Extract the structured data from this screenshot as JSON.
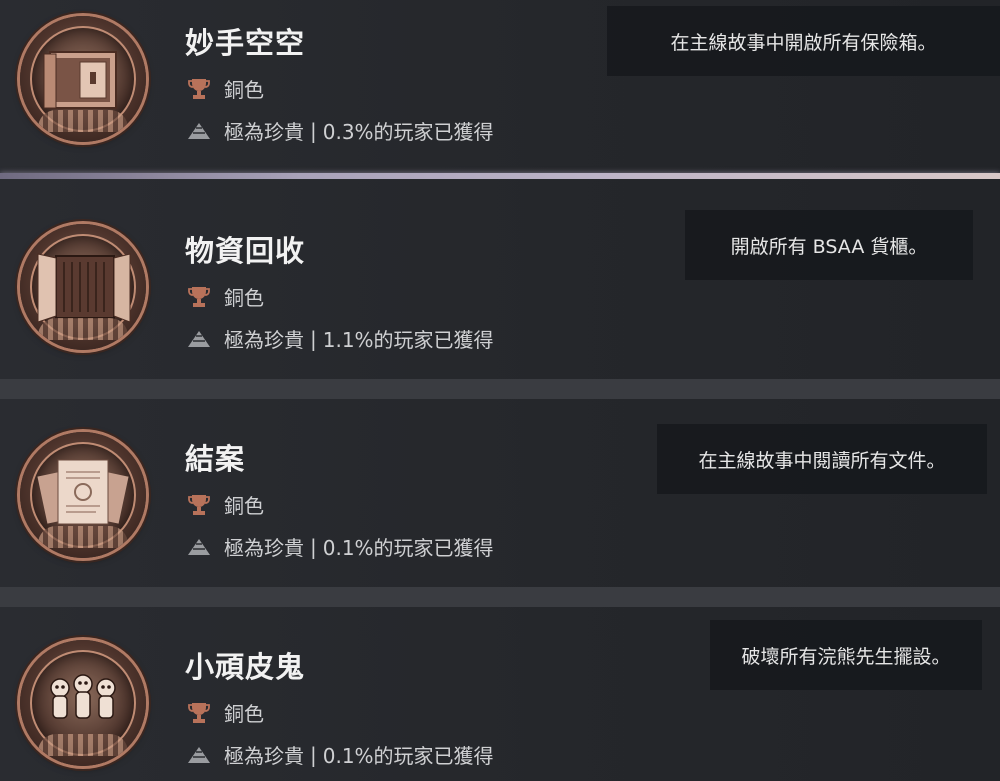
{
  "trophies": [
    {
      "name": "妙手空空",
      "grade": "銅色",
      "rarity": "極為珍貴",
      "percent": "0.3%的玩家已獲得",
      "description": "在主線故事中開啟所有保險箱。",
      "icon": "safe-icon"
    },
    {
      "name": "物資回收",
      "grade": "銅色",
      "rarity": "極為珍貴",
      "percent": "1.1%的玩家已獲得",
      "description": "開啟所有 BSAA 貨櫃。",
      "icon": "container-icon"
    },
    {
      "name": "結案",
      "grade": "銅色",
      "rarity": "極為珍貴",
      "percent": "0.1%的玩家已獲得",
      "description": "在主線故事中閱讀所有文件。",
      "icon": "documents-icon"
    },
    {
      "name": "小頑皮鬼",
      "grade": "銅色",
      "rarity": "極為珍貴",
      "percent": "0.1%的玩家已獲得",
      "description": "破壞所有浣熊先生擺設。",
      "icon": "figurines-icon"
    }
  ],
  "colors": {
    "bronze": "#b8725a",
    "rarity_icon": "#9a9ca0",
    "separator_glow": "#bdb4c8"
  }
}
